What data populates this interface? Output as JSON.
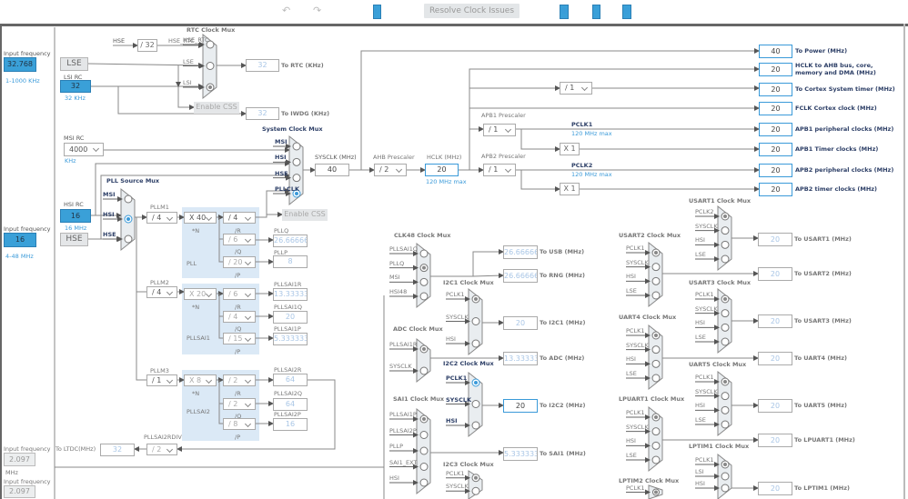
{
  "toolbar": {
    "undo_icon": "undo",
    "redo_icon": "redo",
    "refresh_icon": "refresh",
    "resolve_label": "Resolve Clock Issues",
    "zoom_in_icon": "zoom-in",
    "fit_icon": "fit-to-screen",
    "zoom_out_icon": "zoom-out"
  },
  "colors": {
    "accent": "#3a9ad9",
    "input_fill": "#3aa0d8",
    "pll_region": "#dbe9f6",
    "active_label": "#2c3e66"
  },
  "sources": {
    "lse_input_label": "Input frequency",
    "lse_freq": "32.768",
    "lse_range": "1-1000 KHz",
    "lse_label": "LSE",
    "lsi_title": "LSI RC",
    "lsi_value": "32",
    "lsi_unit": "32 KHz",
    "msi_title": "MSI RC",
    "msi_value": "4000",
    "msi_unit": "KHz",
    "hsi_title": "HSI RC",
    "hsi_value": "16",
    "hsi_unit": "16 MHz",
    "hse_input_label": "Input frequency",
    "hse_freq": "16",
    "hse_range": "4-48 MHz",
    "hse_label": "HSE",
    "ext1_label": "Input frequency",
    "ext1_value": "2.097",
    "ext1_unit": "MHz",
    "ext2_label": "Input frequency",
    "ext2_value": "2.097"
  },
  "rtc": {
    "hse": "HSE",
    "div": "/ 32",
    "hse_rtc": "HSE_RTC",
    "enable_css": "Enable CSS",
    "rtc_value": "32",
    "rtc_label": "To RTC (KHz)",
    "iwdg_value": "32",
    "iwdg_label": "To IWDG (KHz)"
  },
  "system": {
    "enable_css": "Enable CSS",
    "sysclk_label": "SYSCLK (MHz)",
    "sysclk": "40",
    "ahb_label": "AHB Prescaler",
    "ahb": "/ 2",
    "hclk_label": "HCLK (MHz)",
    "hclk": "20",
    "hclk_max": "120 MHz max",
    "cortex_div": "/ 1",
    "apb1_label": "APB1 Prescaler",
    "apb1": "/ 1",
    "pclk1": "PCLK1",
    "pclk1_max": "120 MHz max",
    "apb1_mult": "X 1",
    "apb2_label": "APB2 Prescaler",
    "apb2": "/ 1",
    "pclk2": "PCLK2",
    "pclk2_max": "120 MHz max",
    "apb2_mult": "X 1"
  },
  "outputs": [
    {
      "value": "40",
      "label": "To Power (MHz)"
    },
    {
      "value": "20",
      "label": "HCLK to AHB bus, core,",
      "label2": "memory and DMA (MHz)"
    },
    {
      "value": "20",
      "label": "To Cortex System timer (MHz)"
    },
    {
      "value": "20",
      "label": "FCLK Cortex clock (MHz)"
    },
    {
      "value": "20",
      "label": "APB1 peripheral clocks (MHz)"
    },
    {
      "value": "20",
      "label": "APB1 Timer clocks (MHz)"
    },
    {
      "value": "20",
      "label": "APB2 peripheral clocks (MHz)"
    },
    {
      "value": "20",
      "label": "APB2 timer clocks (MHz)"
    }
  ],
  "pll": {
    "pllm1_label": "PLLM1",
    "pllm1": "/ 4",
    "n1": "X 40",
    "n_label": "*N",
    "r1": "/ 4",
    "q1": "/ 6",
    "p1": "/ 20",
    "r_label": "/R",
    "q_label": "/Q",
    "p_label": "/P",
    "pll_label": "PLL",
    "pllq_label": "PLLQ",
    "pllq": "26.666667",
    "pllp_label": "PLLP",
    "pllp": "8",
    "pllm2_label": "PLLM2",
    "pllm2": "/ 4",
    "n2": "X 20",
    "r2": "/ 6",
    "q2": "/ 4",
    "p2": "/ 15",
    "sai1_label": "PLLSAI1",
    "sai1r_label": "PLLSAI1R",
    "sai1r": "13.333333",
    "sai1q_label": "PLLSAI1Q",
    "sai1q": "20",
    "sai1p_label": "PLLSAI1P",
    "sai1p": "5.333333",
    "pllm3_label": "PLLM3",
    "pllm3": "/ 1",
    "n3": "X 8",
    "r3": "/ 2",
    "q3": "/ 2",
    "p3": "/ 8",
    "sai2_label": "PLLSAI2",
    "sai2r_label": "PLLSAI2R",
    "sai2r": "64",
    "sai2q_label": "PLLSAI2Q",
    "sai2q": "64",
    "sai2p_label": "PLLSAI2P",
    "sai2p": "16",
    "rdiv_label": "PLLSAI2RDIV",
    "rdiv": "/ 2",
    "ltdc_value": "32",
    "ltdc_label": "To LTDC(MHz)"
  },
  "muxes": {
    "rtc": {
      "title": "RTC Clock Mux",
      "inputs": [
        "HSE_RTC",
        "LSE",
        "LSI"
      ],
      "selected": 2,
      "active": false
    },
    "sys": {
      "title": "System Clock Mux",
      "inputs": [
        "MSI",
        "HSI",
        "HSE",
        "PLLCLK"
      ],
      "selected": 3,
      "active": true
    },
    "pllsrc": {
      "title": "PLL Source Mux",
      "inputs": [
        "MSI",
        "HSI",
        "HSE"
      ],
      "selected": 1,
      "active": true
    },
    "clk48": {
      "title": "CLK48 Clock Mux",
      "inputs": [
        "PLLSAI1Q",
        "PLLQ",
        "MSI",
        "HSI48"
      ],
      "selected": 1,
      "active": false
    },
    "i2c1": {
      "title": "I2C1 Clock Mux",
      "inputs": [
        "PCLK1",
        "SYSCLK",
        "HSI"
      ],
      "selected": 0,
      "active": false
    },
    "adc": {
      "title": "ADC Clock Mux",
      "inputs": [
        "PLLSAI1R",
        "SYSCLK"
      ],
      "selected": 0,
      "active": false
    },
    "i2c2": {
      "title": "I2C2 Clock Mux",
      "inputs": [
        "PCLK1",
        "SYSCLK",
        "HSI"
      ],
      "selected": 0,
      "active": true
    },
    "sai1": {
      "title": "SAI1 Clock Mux",
      "inputs": [
        "PLLSAI1P",
        "PLLSAI2P",
        "PLLP",
        "SAI1_EXT",
        "HSI"
      ],
      "selected": 0,
      "active": false
    },
    "i2c3": {
      "title": "I2C3 Clock Mux",
      "inputs": [
        "PCLK1",
        "SYSCLK"
      ],
      "selected": 0,
      "active": false
    },
    "usart1": {
      "title": "USART1 Clock Mux",
      "inputs": [
        "PCLK2",
        "SYSCLK",
        "HSI",
        "LSE"
      ],
      "selected": 0,
      "active": false
    },
    "usart2": {
      "title": "USART2 Clock Mux",
      "inputs": [
        "PCLK1",
        "SYSCLK",
        "HSI",
        "LSE"
      ],
      "selected": 0,
      "active": false
    },
    "usart3": {
      "title": "USART3 Clock Mux",
      "inputs": [
        "PCLK1",
        "SYSCLK",
        "HSI",
        "LSE"
      ],
      "selected": 0,
      "active": false
    },
    "uart4": {
      "title": "UART4 Clock Mux",
      "inputs": [
        "PCLK1",
        "SYSCLK",
        "HSI",
        "LSE"
      ],
      "selected": 0,
      "active": false
    },
    "uart5": {
      "title": "UART5 Clock Mux",
      "inputs": [
        "PCLK1",
        "SYSCLK",
        "HSI",
        "LSE"
      ],
      "selected": 0,
      "active": false
    },
    "lpuart1": {
      "title": "LPUART1 Clock Mux",
      "inputs": [
        "PCLK1",
        "SYSCLK",
        "HSI",
        "LSE"
      ],
      "selected": 0,
      "active": false
    },
    "lptim1": {
      "title": "LPTIM1 Clock Mux",
      "inputs": [
        "PCLK1",
        "LSI",
        "HSI"
      ],
      "selected": 0,
      "active": false
    },
    "lptim2": {
      "title": "LPTIM2 Clock Mux",
      "inputs": [
        "PCLK1"
      ],
      "selected": 0,
      "active": false
    }
  },
  "periph": {
    "usb": {
      "value": "26.666667",
      "label": "To USB (MHz)"
    },
    "rng": {
      "value": "26.666667",
      "label": "To RNG (MHz)"
    },
    "i2c1": {
      "value": "20",
      "label": "To I2C1 (MHz)"
    },
    "adc": {
      "value": "13.333333",
      "label": "To ADC (MHz)"
    },
    "i2c2": {
      "value": "20",
      "label": "To I2C2 (MHz)"
    },
    "sai1": {
      "value": "5.333333",
      "label": "To SAI1 (MHz)"
    },
    "usart1": {
      "value": "20",
      "label": "To USART1 (MHz)"
    },
    "usart2": {
      "value": "20",
      "label": "To USART2 (MHz)"
    },
    "usart3": {
      "value": "20",
      "label": "To USART3 (MHz)"
    },
    "uart4": {
      "value": "20",
      "label": "To UART4 (MHz)"
    },
    "uart5": {
      "value": "20",
      "label": "To UART5 (MHz)"
    },
    "lpuart1": {
      "value": "20",
      "label": "To LPUART1 (MHz)"
    },
    "lptim1": {
      "value": "20",
      "label": "To LPTIM1 (MHz)"
    }
  }
}
